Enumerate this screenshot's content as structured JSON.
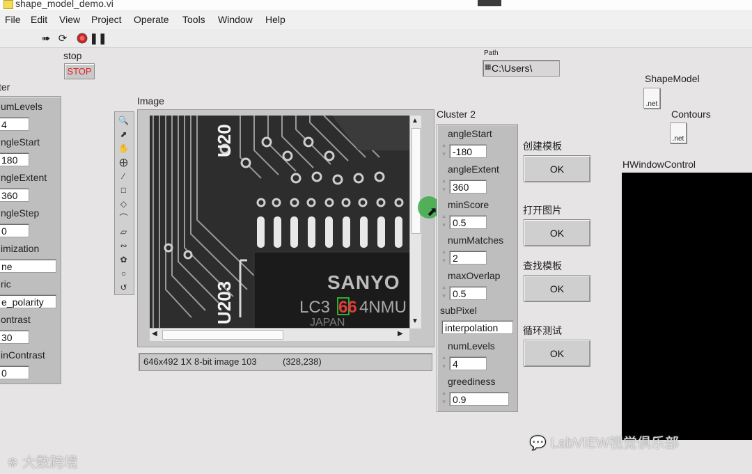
{
  "window": {
    "title": "shape_model_demo.vi"
  },
  "menu": [
    "File",
    "Edit",
    "View",
    "Project",
    "Operate",
    "Tools",
    "Window",
    "Help"
  ],
  "toolbar": {
    "run_icon": "run-arrow-icon",
    "run_continuous_icon": "run-continuous-icon",
    "abort_icon": "abort-icon",
    "pause_icon": "pause-icon"
  },
  "stop": {
    "label": "stop",
    "button": "STOP"
  },
  "path": {
    "label": "Path",
    "value": "C:\\Users\\"
  },
  "shape_model": {
    "label": "ShapeModel",
    "icon_text": ".net"
  },
  "contours": {
    "label": "Contours",
    "icon_text": ".net"
  },
  "left_cluster": {
    "title": "ter",
    "fields": [
      {
        "label": "umLevels",
        "value": "4"
      },
      {
        "label": "ngleStart",
        "value": "180"
      },
      {
        "label": "ngleExtent",
        "value": "360"
      },
      {
        "label": "ngleStep",
        "value": "0"
      },
      {
        "label": "imization",
        "value": "ne"
      },
      {
        "label": "ric",
        "value": "e_polarity"
      },
      {
        "label": "ontrast",
        "value": "30"
      },
      {
        "label": "inContrast",
        "value": "0"
      }
    ]
  },
  "image": {
    "label": "Image",
    "status": "646x492 1X 8-bit image 103",
    "coords": "(328,238)",
    "chip_text_1": "SANYO",
    "chip_text_2": "LC3",
    "chip_text_highlight": "66",
    "chip_text_3": "4NMU",
    "chip_text_4": "JAPAN",
    "pcb_text_1": "U20",
    "pcb_text_2": "U203"
  },
  "cluster2": {
    "title": "Cluster 2",
    "fields": [
      {
        "label": "angleStart",
        "value": "-180"
      },
      {
        "label": "angleExtent",
        "value": "360"
      },
      {
        "label": "minScore",
        "value": "0.5"
      },
      {
        "label": "numMatches",
        "value": "2"
      },
      {
        "label": "maxOverlap",
        "value": "0.5"
      },
      {
        "label": "subPixel",
        "value": "interpolation"
      },
      {
        "label": "numLevels",
        "value": "4"
      },
      {
        "label": "greediness",
        "value": "0.9"
      }
    ]
  },
  "buttons": [
    {
      "label": "创建模板",
      "text": "OK"
    },
    {
      "label": "打开图片",
      "text": "OK"
    },
    {
      "label": "查找模板",
      "text": "OK"
    },
    {
      "label": "循环测试",
      "text": "OK"
    }
  ],
  "hwindow": {
    "label": "HWindowControl"
  },
  "watermark": {
    "left": "大数跨境",
    "right": "LabVIEW视觉俱乐部"
  }
}
